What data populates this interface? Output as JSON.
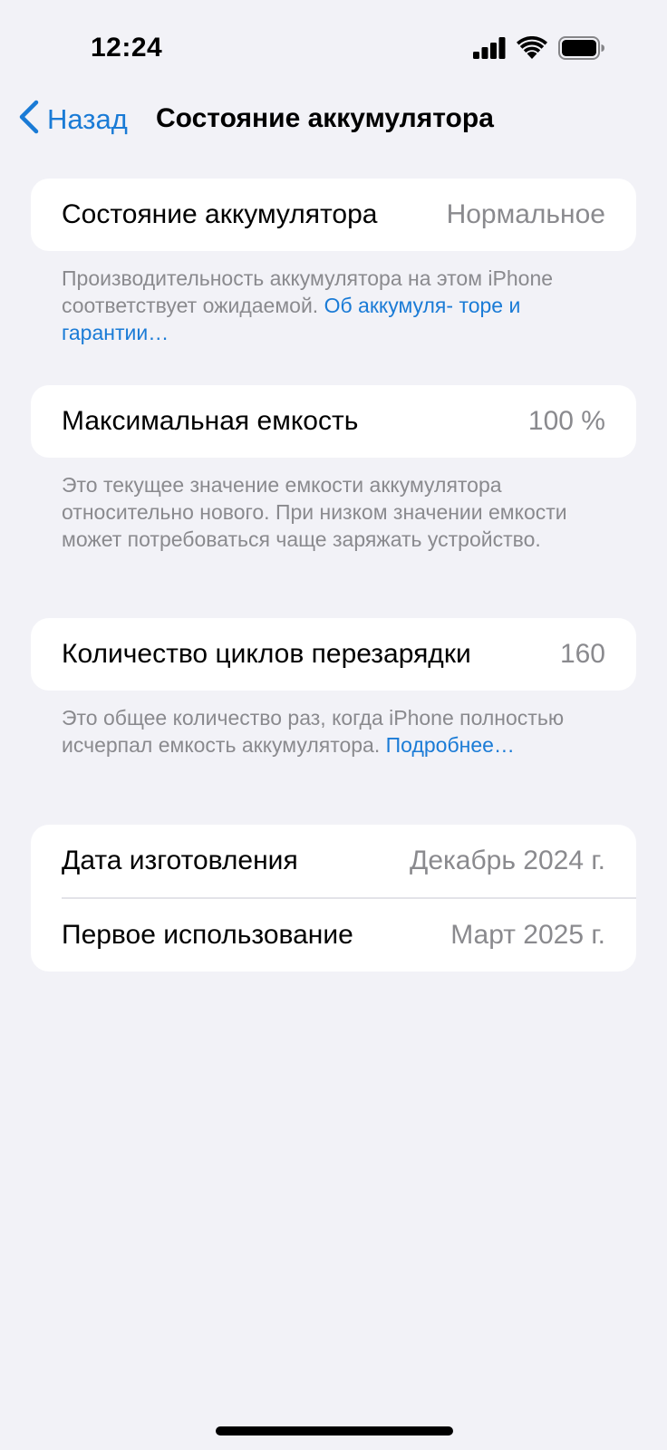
{
  "status_bar": {
    "time": "12:24",
    "icons": [
      "cellular-signal-icon",
      "wifi-icon",
      "battery-icon"
    ]
  },
  "nav": {
    "back_label": "Назад",
    "title": "Состояние аккумулятора"
  },
  "sections": {
    "health": {
      "label": "Состояние аккумулятора",
      "value": "Нормальное",
      "footnote_text": "Производительность аккумулятора на этом iPhone соответствует ожидаемой. ",
      "footnote_link": "Об аккумуля- торе и гарантии…"
    },
    "capacity": {
      "label": "Максимальная емкость",
      "value": "100 %",
      "footnote_text": "Это текущее значение емкости аккумулятора относительно нового. При низком значении емкости может потребоваться чаще заряжать устройство."
    },
    "cycles": {
      "label": "Количество циклов перезарядки",
      "value": "160",
      "footnote_text": "Это общее количество раз, когда iPhone полностью исчерпал емкость аккумулятора. ",
      "footnote_link": "Подробнее…"
    },
    "dates": {
      "manufacture_label": "Дата изготовления",
      "manufacture_value": "Декабрь 2024 г.",
      "first_use_label": "Первое использование",
      "first_use_value": "Март 2025 г."
    }
  },
  "colors": {
    "background": "#f2f2f7",
    "accent": "#1a7bd6",
    "secondary_text": "#8a8a8e"
  }
}
